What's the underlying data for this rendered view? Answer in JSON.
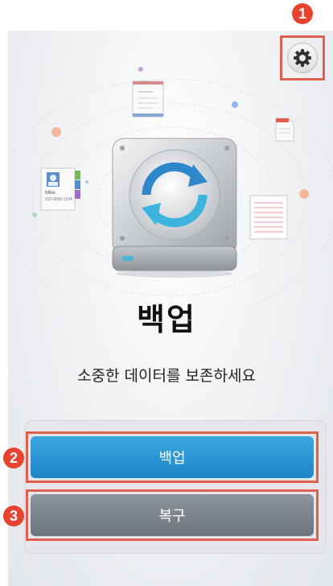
{
  "main": {
    "title": "백업",
    "subtitle": "소중한 데이터를 보존하세요"
  },
  "buttons": {
    "backup_label": "백업",
    "restore_label": "복구"
  },
  "annotations": {
    "badge_1": "1",
    "badge_2": "2",
    "badge_3": "3"
  },
  "illustration": {
    "contact_card_name": "Mike",
    "contact_card_number": "010-0000-1234"
  },
  "icons": {
    "settings": "gear-icon",
    "hero": "backup-sync-drive-icon"
  },
  "colors": {
    "backup_button": "#2a96d6",
    "restore_button": "#7d838b",
    "highlight": "#e06050",
    "badge": "#e8432e"
  }
}
